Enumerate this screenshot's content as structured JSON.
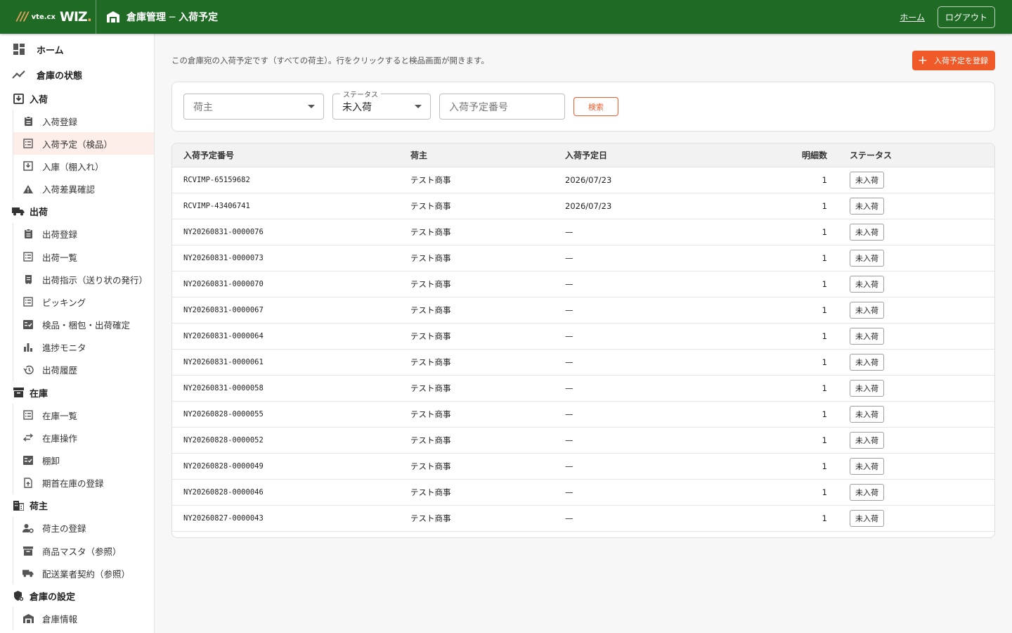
{
  "header": {
    "brand_mark": "///",
    "brand_vtecx": "vte.cx",
    "brand_wiz": "WIZ",
    "brand_dot": ".",
    "title": "倉庫管理 ─ 入荷予定",
    "home_link": "ホーム",
    "logout": "ログアウト"
  },
  "sidebar": {
    "home": "ホーム",
    "warehouse_state": "倉庫の状態",
    "inbound": {
      "label": "入荷",
      "items": [
        "入荷登録",
        "入荷予定（検品）",
        "入庫（棚入れ）",
        "入荷差異確認"
      ]
    },
    "outbound": {
      "label": "出荷",
      "items": [
        "出荷登録",
        "出荷一覧",
        "出荷指示（送り状の発行）",
        "ピッキング",
        "検品・梱包・出荷確定",
        "進捗モニタ",
        "出荷履歴"
      ]
    },
    "inventory": {
      "label": "在庫",
      "items": [
        "在庫一覧",
        "在庫操作",
        "棚卸",
        "期首在庫の登録"
      ]
    },
    "shipper": {
      "label": "荷主",
      "items": [
        "荷主の登録",
        "商品マスタ（参照）",
        "配送業者契約（参照）"
      ]
    },
    "settings": {
      "label": "倉庫の設定",
      "items": [
        "倉庫情報"
      ]
    }
  },
  "main": {
    "description": "この倉庫宛の入荷予定です（すべての荷主）。行をクリックすると検品画面が開きます。",
    "register_button": "入荷予定を登録",
    "filters": {
      "shipper_placeholder": "荷主",
      "status_label": "ステータス",
      "status_value": "未入荷",
      "number_placeholder": "入荷予定番号",
      "search_button": "検索"
    },
    "table": {
      "columns": [
        "入荷予定番号",
        "荷主",
        "入荷予定日",
        "明細数",
        "ステータス"
      ],
      "rows": [
        {
          "number": "RCVIMP-65159682",
          "shipper": "テスト商事",
          "date": "2026/07/23",
          "lines": "1",
          "status": "未入荷"
        },
        {
          "number": "RCVIMP-43406741",
          "shipper": "テスト商事",
          "date": "2026/07/23",
          "lines": "1",
          "status": "未入荷"
        },
        {
          "number": "NY20260831-0000076",
          "shipper": "テスト商事",
          "date": "—",
          "lines": "1",
          "status": "未入荷"
        },
        {
          "number": "NY20260831-0000073",
          "shipper": "テスト商事",
          "date": "—",
          "lines": "1",
          "status": "未入荷"
        },
        {
          "number": "NY20260831-0000070",
          "shipper": "テスト商事",
          "date": "—",
          "lines": "1",
          "status": "未入荷"
        },
        {
          "number": "NY20260831-0000067",
          "shipper": "テスト商事",
          "date": "—",
          "lines": "1",
          "status": "未入荷"
        },
        {
          "number": "NY20260831-0000064",
          "shipper": "テスト商事",
          "date": "—",
          "lines": "1",
          "status": "未入荷"
        },
        {
          "number": "NY20260831-0000061",
          "shipper": "テスト商事",
          "date": "—",
          "lines": "1",
          "status": "未入荷"
        },
        {
          "number": "NY20260831-0000058",
          "shipper": "テスト商事",
          "date": "—",
          "lines": "1",
          "status": "未入荷"
        },
        {
          "number": "NY20260828-0000055",
          "shipper": "テスト商事",
          "date": "—",
          "lines": "1",
          "status": "未入荷"
        },
        {
          "number": "NY20260828-0000052",
          "shipper": "テスト商事",
          "date": "—",
          "lines": "1",
          "status": "未入荷"
        },
        {
          "number": "NY20260828-0000049",
          "shipper": "テスト商事",
          "date": "—",
          "lines": "1",
          "status": "未入荷"
        },
        {
          "number": "NY20260828-0000046",
          "shipper": "テスト商事",
          "date": "—",
          "lines": "1",
          "status": "未入荷"
        },
        {
          "number": "NY20260827-0000043",
          "shipper": "テスト商事",
          "date": "—",
          "lines": "1",
          "status": "未入荷"
        }
      ]
    }
  },
  "colors": {
    "header_bg": "#1f6a24",
    "accent": "#f05a28",
    "active_bg": "#fdeee9"
  }
}
